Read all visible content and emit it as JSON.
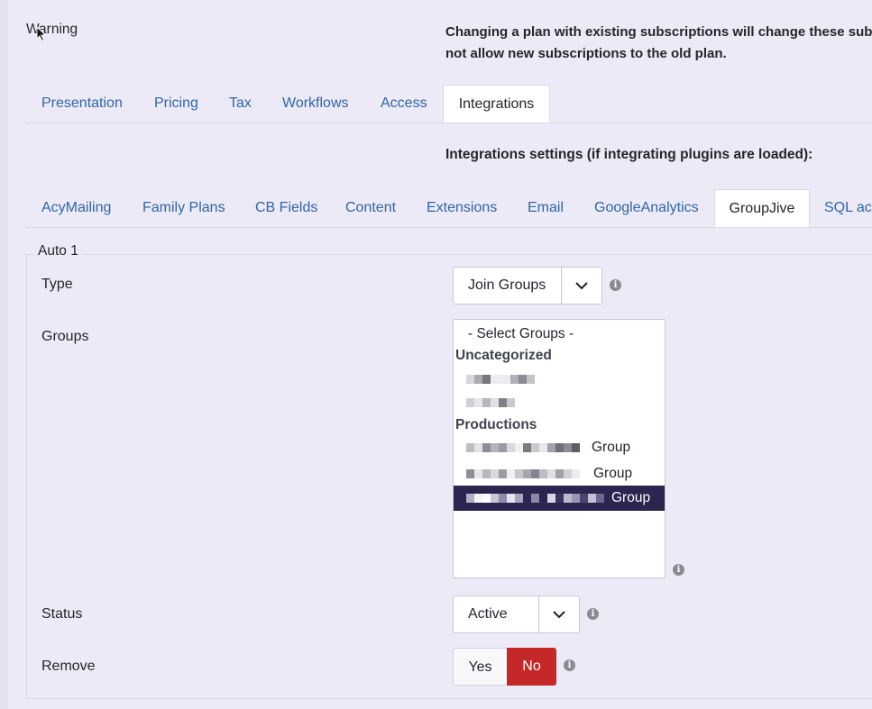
{
  "warning": {
    "label": "Warning",
    "text_line1": "Changing a plan with existing subscriptions will change these subs",
    "text_line2": "not allow new subscriptions to the old plan."
  },
  "main_tabs": [
    {
      "label": "Presentation",
      "active": false
    },
    {
      "label": "Pricing",
      "active": false
    },
    {
      "label": "Tax",
      "active": false
    },
    {
      "label": "Workflows",
      "active": false
    },
    {
      "label": "Access",
      "active": false
    },
    {
      "label": "Integrations",
      "active": true
    }
  ],
  "integrations_heading": "Integrations settings (if integrating plugins are loaded):",
  "integration_tabs": [
    {
      "label": "AcyMailing",
      "active": false
    },
    {
      "label": "Family Plans",
      "active": false
    },
    {
      "label": "CB Fields",
      "active": false
    },
    {
      "label": "Content",
      "active": false
    },
    {
      "label": "Extensions",
      "active": false
    },
    {
      "label": "Email",
      "active": false
    },
    {
      "label": "GoogleAnalytics",
      "active": false
    },
    {
      "label": "GroupJive",
      "active": true
    },
    {
      "label": "SQL act",
      "active": false
    }
  ],
  "auto": {
    "legend": "Auto 1",
    "type_label": "Type",
    "type_value": "Join Groups",
    "groups_label": "Groups",
    "groups_placeholder": "- Select Groups -",
    "group_categories": [
      {
        "name": "Uncategorized"
      },
      {
        "name": "Productions"
      }
    ],
    "group_options": [
      {
        "suffix": "",
        "selected": false
      },
      {
        "suffix": "",
        "selected": false
      },
      {
        "suffix": "Group",
        "selected": false
      },
      {
        "suffix": "Group",
        "selected": false
      },
      {
        "suffix": "Group",
        "selected": true
      }
    ],
    "status_label": "Status",
    "status_value": "Active",
    "remove_label": "Remove",
    "remove_yes": "Yes",
    "remove_no": "No",
    "remove_value": "No"
  },
  "colors": {
    "background": "#eceaf6",
    "link": "#2f66a8",
    "selected_option": "#2b2550",
    "no_button": "#c52828"
  },
  "icons": [
    "cursor-icon",
    "chevron-down-icon",
    "info-icon"
  ]
}
